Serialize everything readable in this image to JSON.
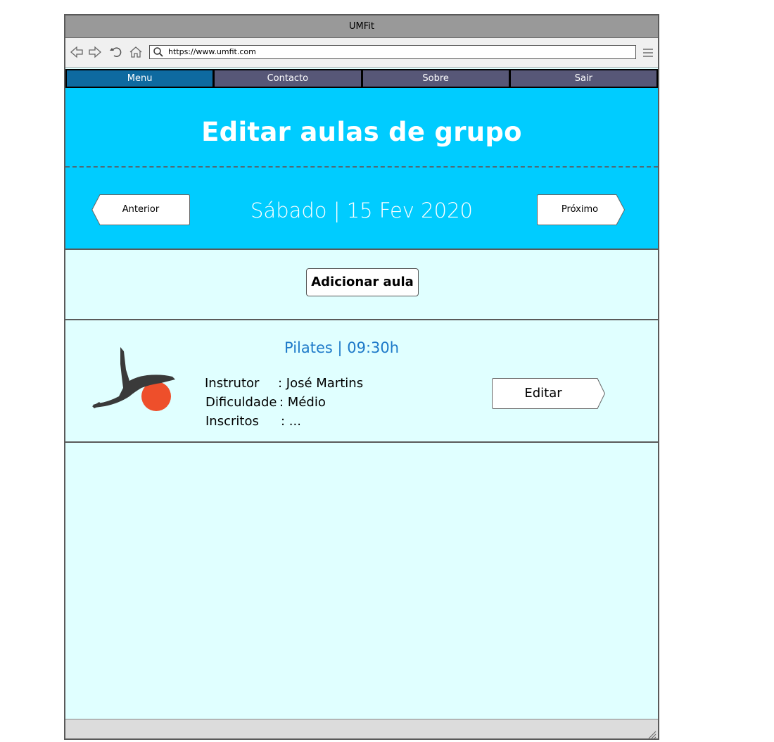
{
  "window": {
    "title": "UMFit"
  },
  "browser": {
    "url": "https://www.umfit.com"
  },
  "nav": {
    "tabs": [
      {
        "label": "Menu",
        "active": true
      },
      {
        "label": "Contacto",
        "active": false
      },
      {
        "label": "Sobre",
        "active": false
      },
      {
        "label": "Sair",
        "active": false
      }
    ]
  },
  "header": {
    "title": "Editar aulas de grupo"
  },
  "day_nav": {
    "prev_label": "Anterior",
    "date": "Sábado | 15 Fev 2020",
    "next_label": "Próximo"
  },
  "actions": {
    "add_label": "Adicionar aula"
  },
  "classes": [
    {
      "title": "Pilates | 09:30h",
      "instructor_label": "Instrutor",
      "instructor_value": ": José Martins",
      "difficulty_label": "Dificuldade",
      "difficulty_value": ": Médio",
      "enrolled_label": "Inscritos",
      "enrolled_value": ": ...",
      "edit_label": "Editar",
      "image_icon": "pilates-ball-icon"
    }
  ],
  "colors": {
    "header_bg": "#00ccff",
    "content_bg": "#e0ffff",
    "tab_active": "#0e6aa0",
    "tab_inactive": "#575777",
    "class_title": "#1e7ac9",
    "ball": "#ee4f2b"
  }
}
